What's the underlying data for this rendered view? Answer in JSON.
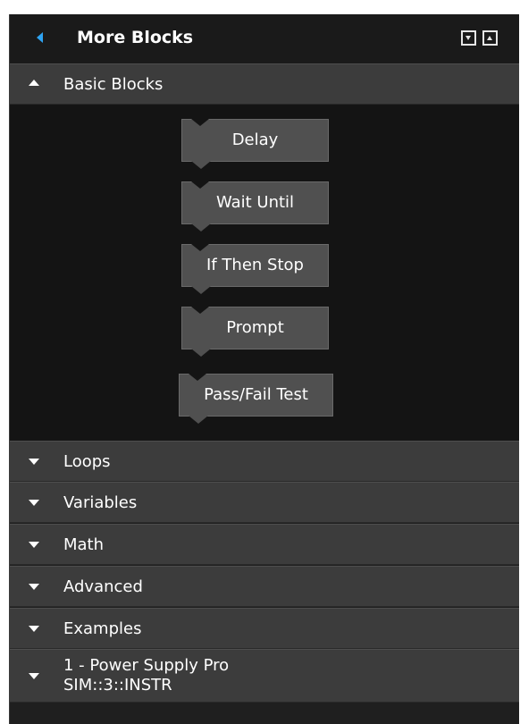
{
  "header": {
    "title": "More Blocks"
  },
  "sections": {
    "basic": {
      "label": "Basic Blocks",
      "expanded": true
    },
    "loops": {
      "label": "Loops"
    },
    "variables": {
      "label": "Variables"
    },
    "math": {
      "label": "Math"
    },
    "advanced": {
      "label": "Advanced"
    },
    "examples": {
      "label": "Examples"
    },
    "instrument": {
      "line1": "1 - Power Supply Pro",
      "line2": "SIM::3::INSTR"
    }
  },
  "blocks": [
    {
      "label": "Delay"
    },
    {
      "label": "Wait Until"
    },
    {
      "label": "If Then Stop"
    },
    {
      "label": "Prompt"
    },
    {
      "label": "Pass/Fail Test"
    }
  ],
  "colors": {
    "accent": "#2ea3f2",
    "panel_bg": "#1f1f1f",
    "section_bg": "#3c3c3c",
    "block_bg": "#505050"
  }
}
